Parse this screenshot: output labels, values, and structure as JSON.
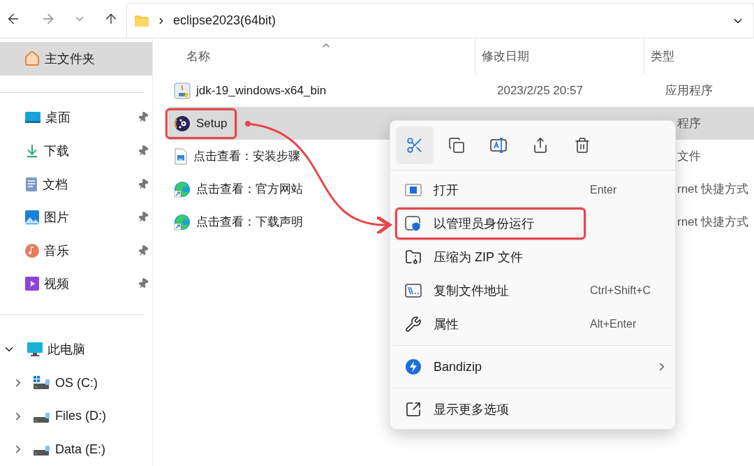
{
  "nav": {
    "path": [
      "eclipse2023(64bit)"
    ]
  },
  "sidebar": {
    "home": {
      "label": "主文件夹",
      "selected": true
    },
    "quick_access": [
      {
        "label": "桌面",
        "kind": "desktop",
        "pinned": true
      },
      {
        "label": "下载",
        "kind": "download",
        "pinned": true
      },
      {
        "label": "文档",
        "kind": "documents",
        "pinned": true
      },
      {
        "label": "图片",
        "kind": "pictures",
        "pinned": true
      },
      {
        "label": "音乐",
        "kind": "music",
        "pinned": true
      },
      {
        "label": "视频",
        "kind": "video",
        "pinned": true
      }
    ],
    "this_pc": {
      "label": "此电脑",
      "expanded": true,
      "children": [
        {
          "label": "OS (C:)",
          "kind": "system",
          "expanded": false
        },
        {
          "label": "Files (D:)",
          "kind": "drive",
          "expanded": false
        },
        {
          "label": "Data (E:)",
          "kind": "drive",
          "expanded": false
        }
      ]
    }
  },
  "table": {
    "columns": [
      {
        "label": "名称",
        "sorted": true
      },
      {
        "label": "修改日期",
        "sorted": false
      },
      {
        "label": "类型",
        "sorted": false
      }
    ],
    "rows": [
      {
        "name": "jdk-19_windows-x64_bin",
        "kind": "installer",
        "date": "2023/2/25 20:57",
        "type": "应用程序",
        "selected": false,
        "highlighted": false
      },
      {
        "name": "Setup",
        "kind": "setup",
        "type": "程序",
        "selected": true,
        "highlighted": true
      },
      {
        "name": "点击查看：安装步骤",
        "kind": "image",
        "type": "文件",
        "selected": false,
        "highlighted": false
      },
      {
        "name": "点击查看：官方网站",
        "kind": "shortcut",
        "type": "rnet 快捷方式",
        "selected": false,
        "highlighted": false
      },
      {
        "name": "点击查看：下载声明",
        "kind": "shortcut",
        "type": "rnet 快捷方式",
        "selected": false,
        "highlighted": false
      }
    ]
  },
  "context_menu": {
    "toolbar": [
      {
        "kind": "cut",
        "hovered": true
      },
      {
        "kind": "copy",
        "hovered": false
      },
      {
        "kind": "rename",
        "hovered": false
      },
      {
        "kind": "share",
        "hovered": false
      },
      {
        "kind": "delete",
        "hovered": false
      }
    ],
    "items": [
      {
        "kind": "item",
        "label": "打开",
        "shortcut": "Enter",
        "highlighted": false
      },
      {
        "kind": "item",
        "label": "以管理员身份运行",
        "highlighted": true
      },
      {
        "kind": "item",
        "label": "压缩为 ZIP 文件",
        "highlighted": false
      },
      {
        "kind": "item",
        "label": "复制文件地址",
        "shortcut": "Ctrl+Shift+C",
        "highlighted": false
      },
      {
        "kind": "item",
        "label": "属性",
        "shortcut": "Alt+Enter",
        "highlighted": false
      },
      {
        "kind": "separator"
      },
      {
        "kind": "submenu",
        "label": "Bandizip",
        "highlighted": false
      },
      {
        "kind": "separator"
      },
      {
        "kind": "item",
        "label": "显示更多选项",
        "highlighted": false
      }
    ]
  }
}
